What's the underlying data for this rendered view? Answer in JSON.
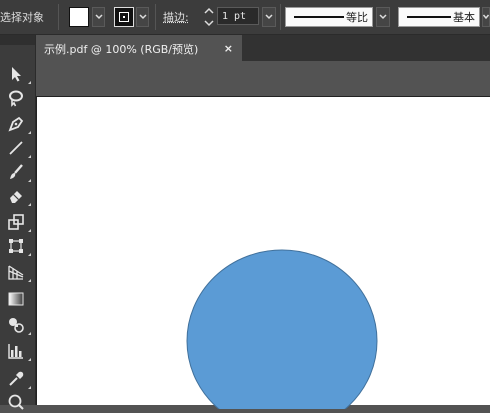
{
  "control_bar": {
    "selection_label": "选择对象",
    "stroke_label": "描边:",
    "stroke_weight": "1 pt",
    "variable_width_profile": "等比",
    "brush_definition": "基本"
  },
  "document_tab": {
    "title": "示例.pdf @ 100% (RGB/预览)",
    "close_glyph": "×"
  },
  "tools": [
    "selection-tool",
    "lasso-tool",
    "pen-tool",
    "line-segment-tool",
    "paintbrush-tool",
    "eraser-tool",
    "scale-tool",
    "free-transform-tool",
    "perspective-grid-tool",
    "gradient-tool",
    "shape-builder-tool",
    "column-graph-tool",
    "eyedropper-tool",
    "zoom-tool"
  ],
  "colors": {
    "ui_dark": "#3c3c3c",
    "canvas_gray": "#535353",
    "artboard": "#ffffff",
    "circle_fill": "#5b9bd5",
    "circle_stroke": "#41719c"
  }
}
